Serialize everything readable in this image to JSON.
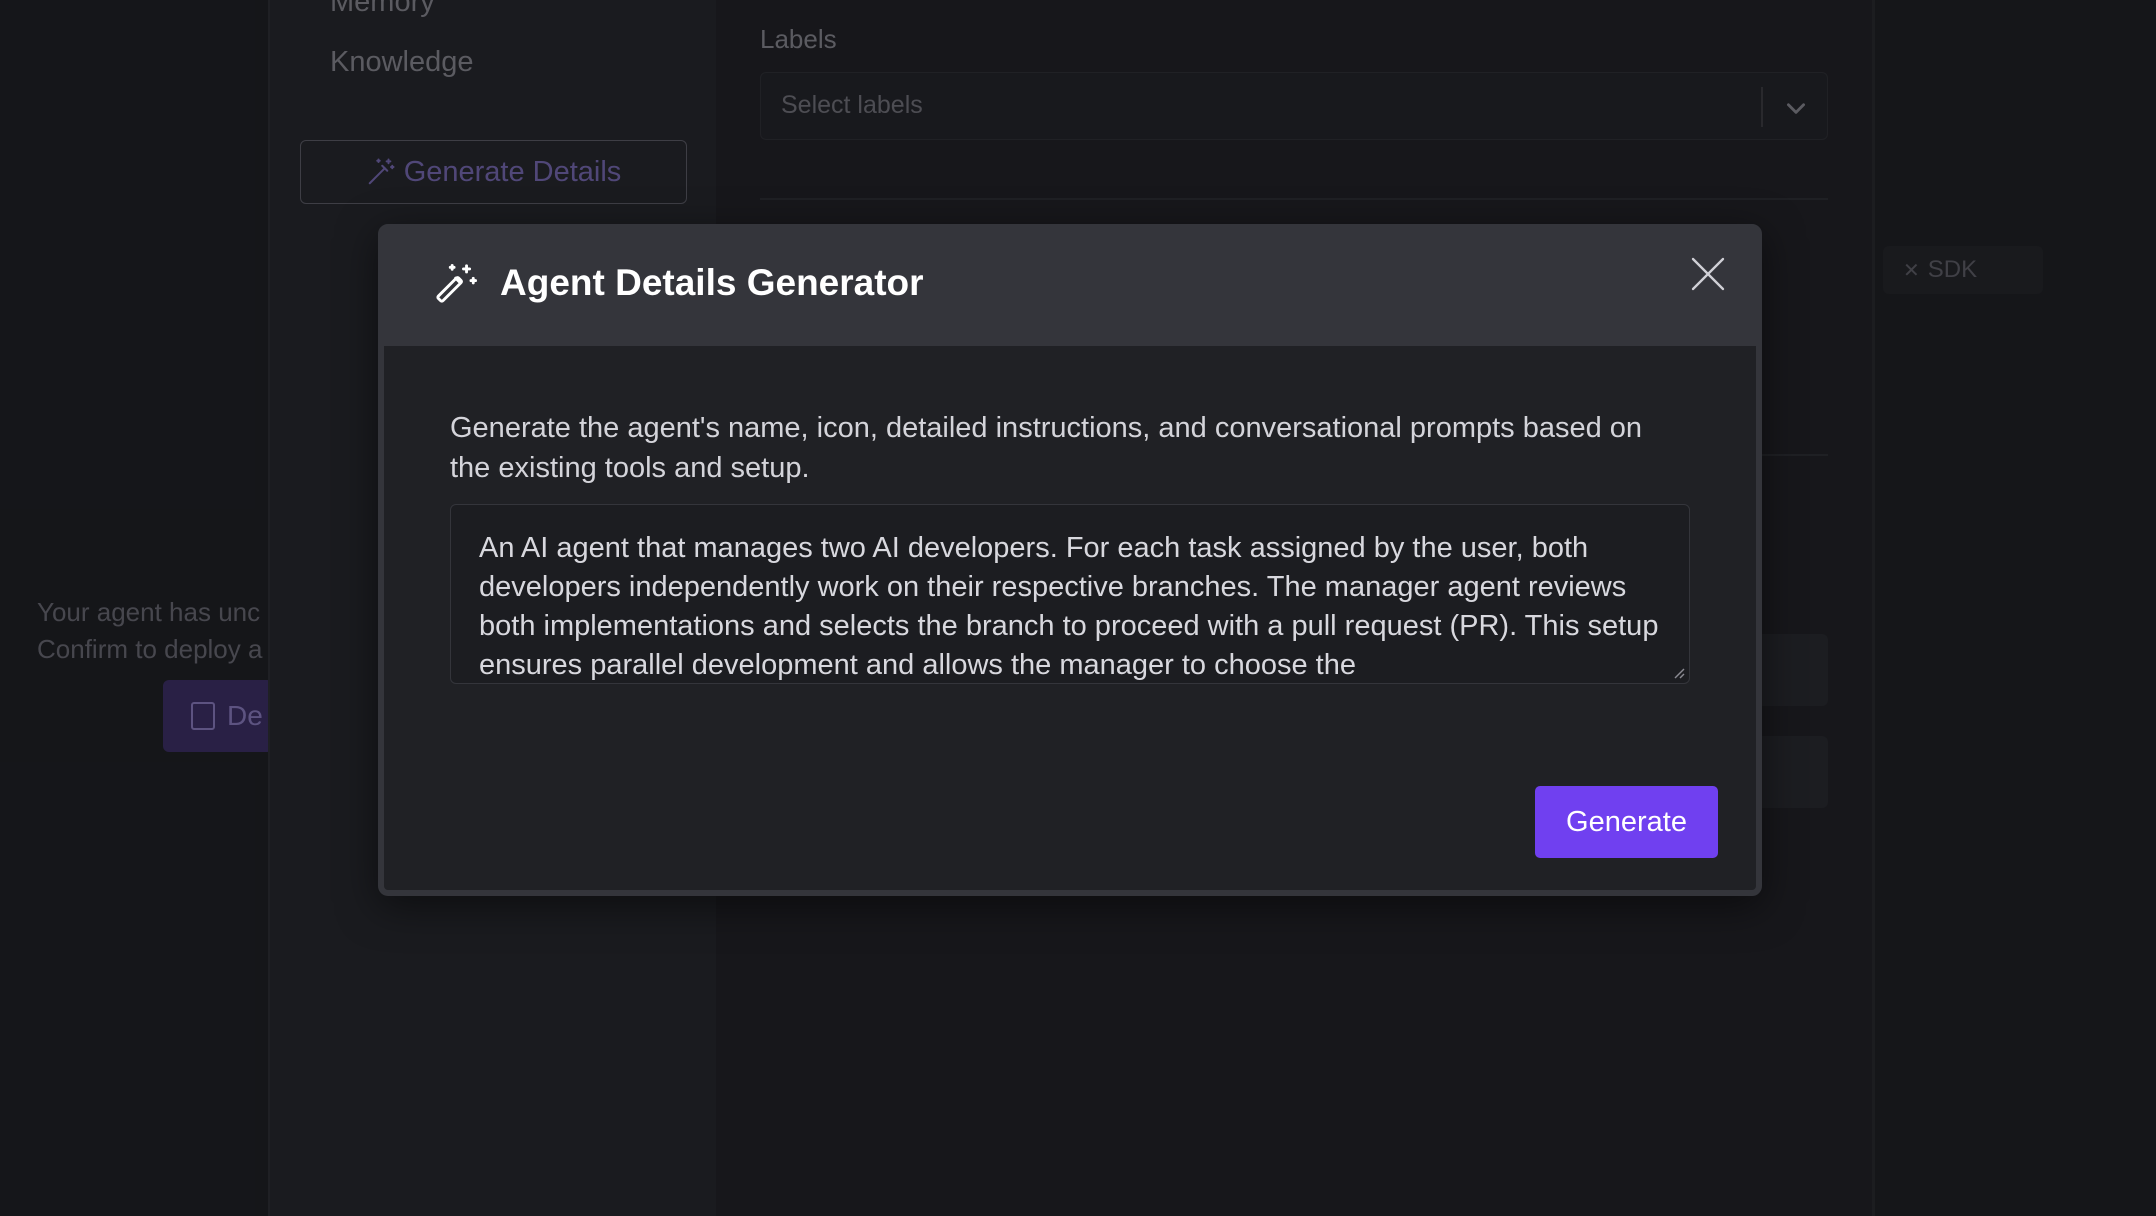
{
  "background": {
    "deploy_notice_line1": "Your agent has unc",
    "deploy_notice_line2": "Confirm to deploy a",
    "deploy_button_label": "De",
    "sidebar": {
      "items": [
        {
          "label": "Memory"
        },
        {
          "label": "Knowledge"
        }
      ],
      "generate_details_label": "Generate Details"
    },
    "labels_field": {
      "label": "Labels",
      "placeholder": "Select labels"
    },
    "sdk_chip_label": "SDK"
  },
  "modal": {
    "title": "Agent Details Generator",
    "description": "Generate the agent's name, icon, detailed instructions, and conversational prompts based on the existing tools and setup.",
    "prompt_value": "An AI agent that manages two AI developers. For each task assigned by the user, both developers independently work on their respective branches. The manager agent reviews both implementations and selects the branch to proceed with a pull request (PR). This setup ensures parallel development and allows the manager to choose the",
    "generate_label": "Generate",
    "accent_color": "#7040f0"
  },
  "icons": {
    "wand": "magic-wand-icon",
    "close": "close-icon",
    "chevron": "chevron-down-icon"
  }
}
